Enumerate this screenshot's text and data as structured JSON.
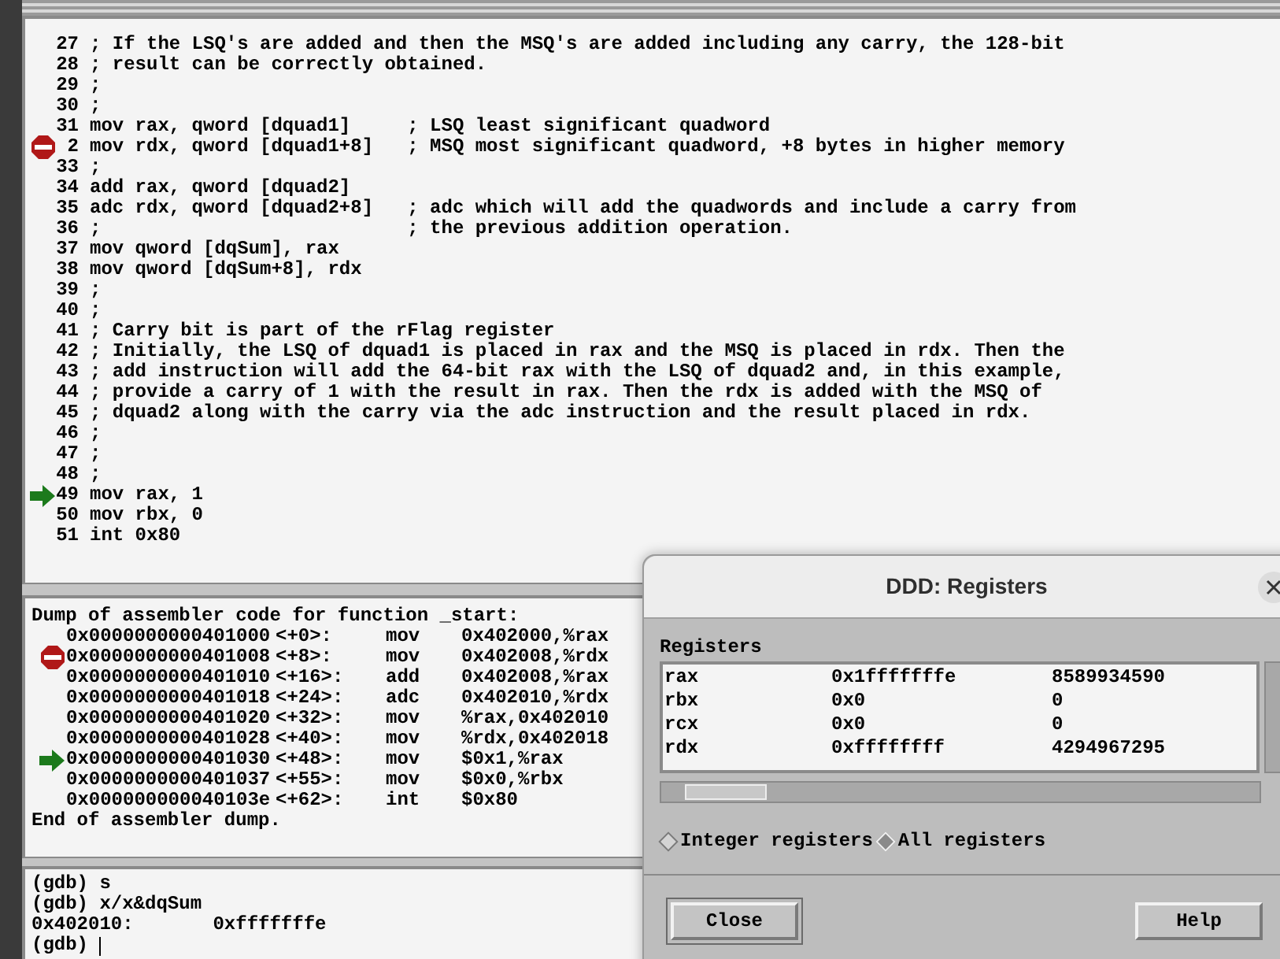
{
  "source_lines": [
    {
      "number": "27",
      "text": "; If the LSQ's are added and then the MSQ's are added including any carry, the 128-bit",
      "kind": "plain"
    },
    {
      "number": "28",
      "text": "; result can be correctly obtained.",
      "kind": "plain"
    },
    {
      "number": "29",
      "text": ";",
      "kind": "plain"
    },
    {
      "number": "30",
      "text": ";",
      "kind": "plain"
    },
    {
      "number": "31",
      "text": "mov rax, qword [dquad1]     ; LSQ least significant quadword",
      "kind": "plain"
    },
    {
      "number": "2",
      "text": "mov rdx, qword [dquad1+8]   ; MSQ most significant quadword, +8 bytes in higher memory",
      "kind": "breakpoint"
    },
    {
      "number": "33",
      "text": ";",
      "kind": "plain"
    },
    {
      "number": "34",
      "text": "add rax, qword [dquad2]",
      "kind": "plain"
    },
    {
      "number": "35",
      "text": "adc rdx, qword [dquad2+8]   ; adc which will add the quadwords and include a carry from",
      "kind": "plain"
    },
    {
      "number": "36",
      "text": ";                           ; the previous addition operation.",
      "kind": "plain"
    },
    {
      "number": "37",
      "text": "mov qword [dqSum], rax",
      "kind": "plain"
    },
    {
      "number": "38",
      "text": "mov qword [dqSum+8], rdx",
      "kind": "plain"
    },
    {
      "number": "39",
      "text": ";",
      "kind": "plain"
    },
    {
      "number": "40",
      "text": ";",
      "kind": "plain"
    },
    {
      "number": "41",
      "text": "; Carry bit is part of the rFlag register",
      "kind": "plain"
    },
    {
      "number": "42",
      "text": "; Initially, the LSQ of dquad1 is placed in rax and the MSQ is placed in rdx. Then the",
      "kind": "plain"
    },
    {
      "number": "43",
      "text": "; add instruction will add the 64-bit rax with the LSQ of dquad2 and, in this example,",
      "kind": "plain"
    },
    {
      "number": "44",
      "text": "; provide a carry of 1 with the result in rax. Then the rdx is added with the MSQ of",
      "kind": "plain"
    },
    {
      "number": "45",
      "text": "; dquad2 along with the carry via the adc instruction and the result placed in rdx.",
      "kind": "plain"
    },
    {
      "number": "46",
      "text": ";",
      "kind": "plain"
    },
    {
      "number": "47",
      "text": ";",
      "kind": "plain"
    },
    {
      "number": "48",
      "text": ";",
      "kind": "plain"
    },
    {
      "number": "49",
      "text": "mov rax, 1",
      "kind": "current"
    },
    {
      "number": "50",
      "text": "mov rbx, 0",
      "kind": "plain"
    },
    {
      "number": "51",
      "text": "int 0x80",
      "kind": "plain"
    }
  ],
  "disassembly": {
    "header": "Dump of assembler code for function _start:",
    "rows": [
      {
        "address": "0x0000000000401000",
        "offset": "<+0>:",
        "mnemonic": "mov",
        "operands": "0x402000,%rax",
        "kind": "plain"
      },
      {
        "address": "0x0000000000401008",
        "offset": "<+8>:",
        "mnemonic": "mov",
        "operands": "0x402008,%rdx",
        "kind": "breakpoint"
      },
      {
        "address": "0x0000000000401010",
        "offset": "<+16>:",
        "mnemonic": "add",
        "operands": "0x402008,%rax",
        "kind": "plain"
      },
      {
        "address": "0x0000000000401018",
        "offset": "<+24>:",
        "mnemonic": "adc",
        "operands": "0x402010,%rdx",
        "kind": "plain"
      },
      {
        "address": "0x0000000000401020",
        "offset": "<+32>:",
        "mnemonic": "mov",
        "operands": "%rax,0x402010",
        "kind": "plain"
      },
      {
        "address": "0x0000000000401028",
        "offset": "<+40>:",
        "mnemonic": "mov",
        "operands": "%rdx,0x402018",
        "kind": "plain"
      },
      {
        "address": "0x0000000000401030",
        "offset": "<+48>:",
        "mnemonic": "mov",
        "operands": "$0x1,%rax",
        "kind": "current"
      },
      {
        "address": "0x0000000000401037",
        "offset": "<+55>:",
        "mnemonic": "mov",
        "operands": "$0x0,%rbx",
        "kind": "plain"
      },
      {
        "address": "0x000000000040103e",
        "offset": "<+62>:",
        "mnemonic": "int",
        "operands": "$0x80",
        "kind": "plain"
      }
    ],
    "footer": "End of assembler dump."
  },
  "console": {
    "lines": [
      "(gdb) s",
      "(gdb) x/x&dqSum",
      "0x402010:       0xfffffffe"
    ],
    "prompt": "(gdb)"
  },
  "registers_dialog": {
    "title": "DDD: Registers",
    "label": "Registers",
    "rows": [
      {
        "name": "rax",
        "hex": "0x1fffffffe",
        "decimal": "8589934590"
      },
      {
        "name": "rbx",
        "hex": "0x0",
        "decimal": "0"
      },
      {
        "name": "rcx",
        "hex": "0x0",
        "decimal": "0"
      },
      {
        "name": "rdx",
        "hex": "0xffffffff",
        "decimal": "4294967295"
      }
    ],
    "options": [
      {
        "label": "Integer registers",
        "selected": false
      },
      {
        "label": "All registers",
        "selected": true
      }
    ],
    "buttons": [
      {
        "label": "Close",
        "default": true
      },
      {
        "label": "Help",
        "default": false
      }
    ]
  }
}
